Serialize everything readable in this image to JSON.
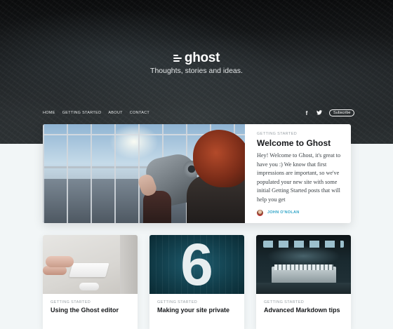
{
  "site": {
    "name": "ghost",
    "tagline": "Thoughts, stories and ideas."
  },
  "nav": {
    "items": [
      "HOME",
      "GETTING STARTED",
      "ABOUT",
      "CONTACT"
    ],
    "social": {
      "facebook_glyph": "f",
      "twitter_glyph": "🐦"
    },
    "subscribe_label": "Subscribe"
  },
  "featured": {
    "tag": "GETTING STARTED",
    "title": "Welcome to Ghost",
    "excerpt": "Hey! Welcome to Ghost, it's great to have you :) We know that first impressions are important, so we've populated your new site with some initial Getting Started posts that will help you get",
    "author": "JOHN O'NOLAN"
  },
  "cards": [
    {
      "tag": "GETTING STARTED",
      "title": "Using the Ghost editor"
    },
    {
      "tag": "GETTING STARTED",
      "title": "Making your site private",
      "image_text": "6"
    },
    {
      "tag": "GETTING STARTED",
      "title": "Advanced Markdown tips"
    }
  ],
  "colors": {
    "accent": "#2fa4c7",
    "background": "#f2f6f7",
    "hero": "#16191b"
  },
  "icons": {
    "logo": "ghost-logo-icon",
    "facebook": "facebook-icon",
    "twitter": "twitter-icon"
  }
}
